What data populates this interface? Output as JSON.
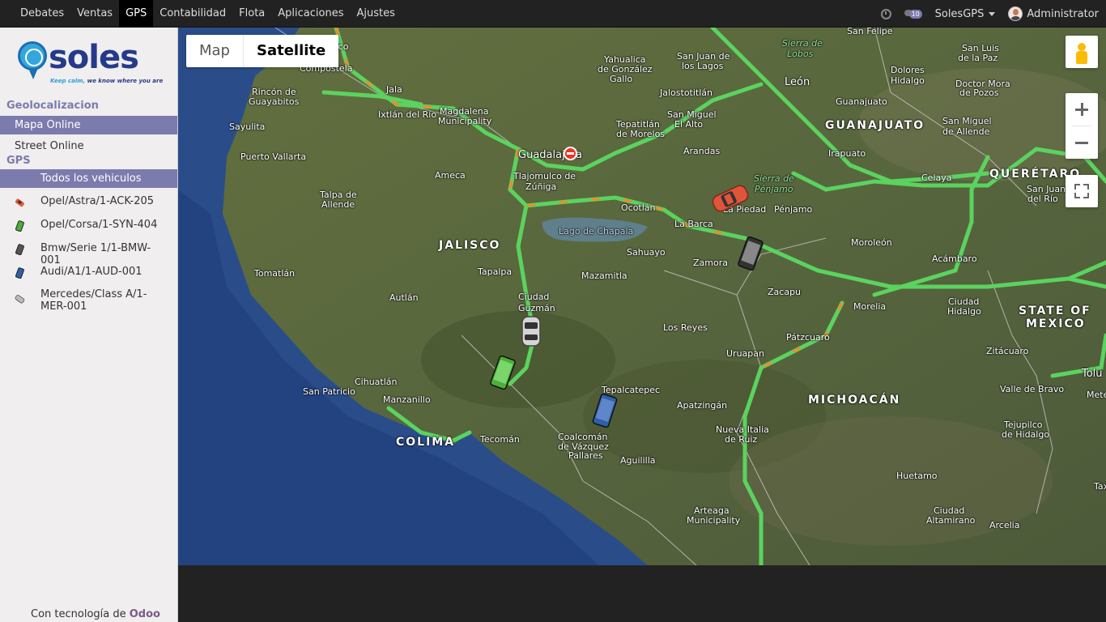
{
  "topbar": {
    "nav": [
      "Debates",
      "Ventas",
      "GPS",
      "Contabilidad",
      "Flota",
      "Aplicaciones",
      "Ajustes"
    ],
    "active": "GPS",
    "chat_badge": "10",
    "company": "SolesGPS",
    "user": "Administrator"
  },
  "sidebar": {
    "logo_text": "soles",
    "logo_tagline_a": "Keep calm,",
    "logo_tagline_b": " we know where you are",
    "section1": "Geolocalizacion",
    "mapa_online": "Mapa Online",
    "street_online": "Street Online",
    "section2": "GPS",
    "todos": "Todos los vehiculos",
    "vehicles": [
      {
        "label": "Opel/Astra/1-ACK-205",
        "color": "#e05a3a"
      },
      {
        "label": "Opel/Corsa/1-SYN-404",
        "color": "#4caf38"
      },
      {
        "label": "Bmw/Serie 1/1-BMW-001",
        "color": "#444444"
      },
      {
        "label": "Audi/A1/1-AUD-001",
        "color": "#2f5fa8"
      },
      {
        "label": "Mercedes/Class A/1-MER-001",
        "color": "#999999"
      }
    ],
    "powered_prefix": "Con tecnología de ",
    "powered_brand": "Odoo"
  },
  "map": {
    "type_map": "Map",
    "type_satellite": "Satellite",
    "selected_type": "Satellite",
    "labels": {
      "jalisco": "JALISCO",
      "colima": "COLIMA",
      "michoacan": "MICHOACÁN",
      "guanajuato": "GUANAJUATO",
      "queretaro": "QUERÉTARO",
      "state_mexico_1": "STATE OF",
      "state_mexico_2": "MEXICO",
      "guadalajara": "Guadalajara",
      "tlajomulco_1": "Tlajomulco de",
      "tlajomulco_2": "Zúñiga",
      "lago": "Lago de Chapala",
      "leon": "León",
      "puerto_vallarta": "Puerto Vallarta",
      "ameca": "Ameca",
      "ocotlan": "Ocotlán",
      "la_barca": "La Barca",
      "la_piedad": "La Piedad",
      "penjamo": "Pénjamo",
      "sahuayo": "Sahuayo",
      "zamora": "Zamora",
      "morelia": "Morelia",
      "uruapan": "Uruapan",
      "patzcuaro": "Pátzcuaro",
      "ciudad_guzman_1": "Ciudad",
      "ciudad_guzman_2": "Guzmán",
      "manzanillo": "Manzanillo",
      "tecoman": "Tecomán",
      "celaya": "Celaya",
      "irapuato": "Irapuato",
      "guanajuato_city": "Guanajuato",
      "san_miguel_1": "San Miguel",
      "san_miguel_2": "de Allende",
      "dolores_1": "Dolores",
      "dolores_2": "Hidalgo",
      "tepatitlan_1": "Tepatitlán",
      "tepatitlan_2": "de Morelos",
      "arandas": "Arandas",
      "compostela": "Compostela",
      "ixtlan": "Ixtlán del Río",
      "magdalena_1": "Magdalena",
      "magdalena_2": "Municipality",
      "jala": "Jala",
      "rincon_1": "Rincón de",
      "rincon_2": "Guayabitos",
      "sayulita": "Sayulita",
      "talpa_1": "Talpa de",
      "talpa_2": "Allende",
      "tomatlan": "Tomatlán",
      "autlan": "Autlán",
      "tapalpa": "Tapalpa",
      "mazamitla": "Mazamitla",
      "cihuatlan": "Cihuatlán",
      "san_patricio": "San Patricio",
      "tepalcatepec": "Tepalcatepec",
      "coalcoman_1": "Coalcomán",
      "coalcoman_2": "de Vázquez",
      "coalcoman_3": "Pallares",
      "aguililla": "Aguililla",
      "apatzingan": "Apatzingán",
      "los_reyes": "Los Reyes",
      "zacapu": "Zacapu",
      "moroleon": "Moroleón",
      "acambaro": "Acámbaro",
      "ciudad_hidalgo_1": "Ciudad",
      "ciudad_hidalgo_2": "Hidalgo",
      "zitacuaro": "Zitácuaro",
      "nueva_italia_1": "Nueva Italia",
      "nueva_italia_2": "de Ruiz",
      "arteaga_1": "Arteaga",
      "arteaga_2": "Municipality",
      "huetamo": "Huetamo",
      "ciudad_altamirano_1": "Ciudad",
      "ciudad_altamirano_2": "Altamirano",
      "arcelia": "Arcelia",
      "tejupilco_1": "Tejupilco",
      "tejupilco_2": "de Hidalgo",
      "valle_bravo": "Valle de Bravo",
      "yahualica_1": "Yahualica",
      "yahualica_2": "de González",
      "yahualica_3": "Gallo",
      "san_juan_1": "San Juan de",
      "san_juan_2": "los Lagos",
      "jalostotitlan": "Jalostotitlán",
      "san_miguel_alto_1": "San Miguel",
      "san_miguel_alto_2": "El Alto",
      "sierra_lobos_1": "Sierra de",
      "sierra_lobos_2": "Lobos",
      "sierra_penjamo_1": "Sierra de",
      "sierra_penjamo_2": "Pénjamo",
      "san_felipe": "San Felipe",
      "san_luis_1": "San Luis",
      "san_luis_2": "de la Paz",
      "doctor_mora_1": "Doctor Mora",
      "doctor_mora_2": "de Pozos",
      "san_juan_rio_1": "San Juan",
      "san_juan_rio_2": "del Río",
      "toluca": "Tolu",
      "metep": "Mete",
      "tax": "Tax",
      "lixico": "lixico"
    }
  }
}
